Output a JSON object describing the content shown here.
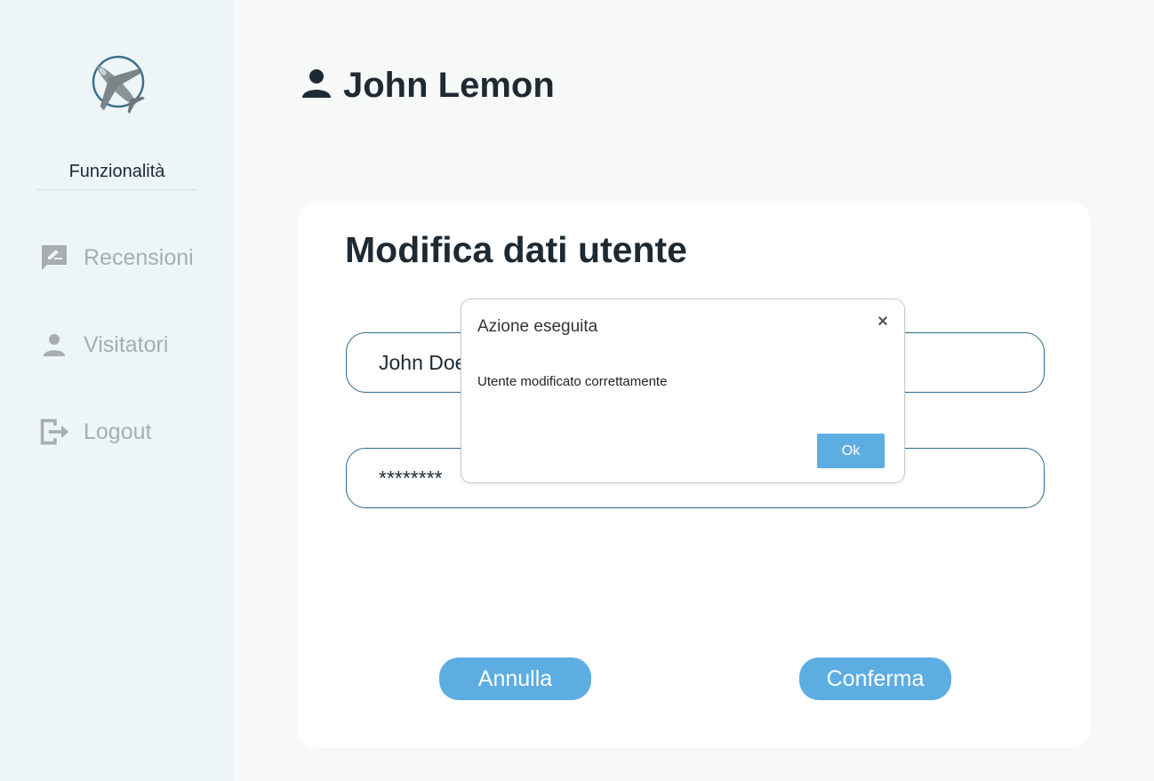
{
  "sidebar": {
    "logo_icon": "airplane-logo-icon",
    "section_title": "Funzionalità",
    "items": [
      {
        "label": "Recensioni",
        "icon": "review-icon"
      },
      {
        "label": "Visitatori",
        "icon": "person-icon"
      },
      {
        "label": "Logout",
        "icon": "logout-icon"
      }
    ]
  },
  "header": {
    "user_icon": "user-icon",
    "user_name": "John Lemon"
  },
  "main": {
    "title": "Modifica dati utente",
    "fields": {
      "username_value": "John Doe",
      "password_value": "********"
    },
    "cancel_label": "Annulla",
    "confirm_label": "Conferma"
  },
  "modal": {
    "title": "Azione eseguita",
    "close_symbol": "×",
    "message": "Utente modificato correttamente",
    "ok_label": "Ok"
  },
  "colors": {
    "sidebar_bg": "#edf5f8",
    "accent": "#5dade2",
    "field_border": "#2e6a8d",
    "text_dark": "#1e2a33",
    "nav_muted": "#a7adb1"
  }
}
